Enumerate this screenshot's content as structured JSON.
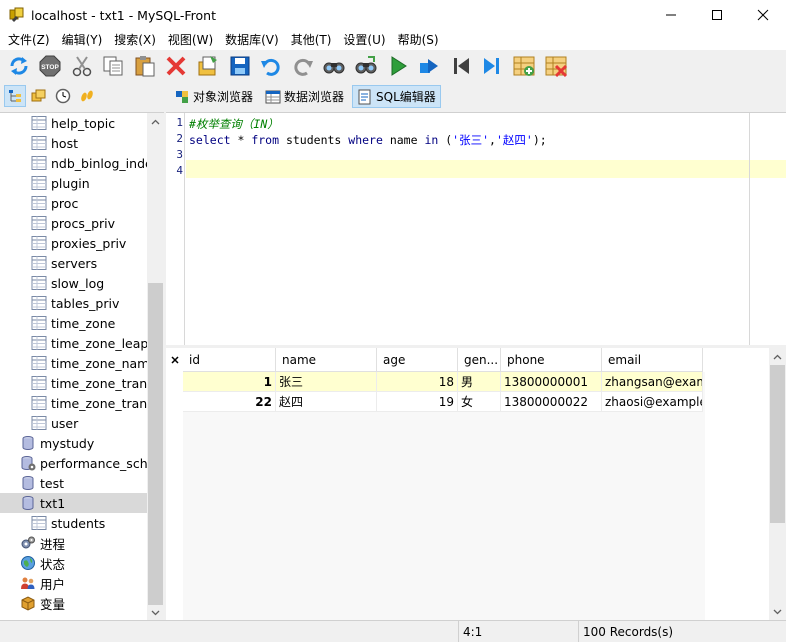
{
  "window": {
    "title": "localhost - txt1 - MySQL-Front"
  },
  "menu": [
    "文件(Z)",
    "编辑(Y)",
    "搜索(X)",
    "视图(W)",
    "数据库(V)",
    "其他(T)",
    "设置(U)",
    "帮助(S)"
  ],
  "toolbar": {
    "icons": [
      "refresh-icon",
      "stop-icon",
      "cut-icon",
      "copy-icon",
      "paste-icon",
      "delete-icon",
      "open-icon",
      "save-icon",
      "undo-icon",
      "redo-icon",
      "find-icon",
      "replace-icon",
      "run-icon",
      "run-selection-icon",
      "first-icon",
      "last-icon",
      "insert-row-icon",
      "delete-row-icon"
    ]
  },
  "view_tabs": [
    {
      "label": "对象浏览器",
      "active": false
    },
    {
      "label": "数据浏览器",
      "active": false
    },
    {
      "label": "SQL编辑器",
      "active": true
    }
  ],
  "tree": [
    {
      "label": "help_topic",
      "level": 2,
      "icon": "table-icon"
    },
    {
      "label": "host",
      "level": 2,
      "icon": "table-icon"
    },
    {
      "label": "ndb_binlog_index",
      "level": 2,
      "icon": "table-icon"
    },
    {
      "label": "plugin",
      "level": 2,
      "icon": "table-icon"
    },
    {
      "label": "proc",
      "level": 2,
      "icon": "table-icon"
    },
    {
      "label": "procs_priv",
      "level": 2,
      "icon": "table-icon"
    },
    {
      "label": "proxies_priv",
      "level": 2,
      "icon": "table-icon"
    },
    {
      "label": "servers",
      "level": 2,
      "icon": "table-icon"
    },
    {
      "label": "slow_log",
      "level": 2,
      "icon": "table-icon"
    },
    {
      "label": "tables_priv",
      "level": 2,
      "icon": "table-icon"
    },
    {
      "label": "time_zone",
      "level": 2,
      "icon": "table-icon"
    },
    {
      "label": "time_zone_leap_second",
      "level": 2,
      "icon": "table-icon"
    },
    {
      "label": "time_zone_name",
      "level": 2,
      "icon": "table-icon"
    },
    {
      "label": "time_zone_transition",
      "level": 2,
      "icon": "table-icon"
    },
    {
      "label": "time_zone_transition_type",
      "level": 2,
      "icon": "table-icon"
    },
    {
      "label": "user",
      "level": 2,
      "icon": "table-icon"
    },
    {
      "label": "mystudy",
      "level": 1,
      "icon": "database-icon"
    },
    {
      "label": "performance_schema",
      "level": 1,
      "icon": "system-database-icon"
    },
    {
      "label": "test",
      "level": 1,
      "icon": "database-icon"
    },
    {
      "label": "txt1",
      "level": 1,
      "icon": "database-icon",
      "selected": true
    },
    {
      "label": "students",
      "level": 2,
      "icon": "table-icon"
    },
    {
      "label": "进程",
      "level": 1,
      "icon": "process-icon"
    },
    {
      "label": "状态",
      "level": 1,
      "icon": "status-icon"
    },
    {
      "label": "用户",
      "level": 1,
      "icon": "users-icon"
    },
    {
      "label": "变量",
      "level": 1,
      "icon": "variables-icon"
    }
  ],
  "editor": {
    "line_numbers": [
      "1",
      "2",
      "3",
      "4"
    ],
    "line1_comment": "#枚举查询（IN）",
    "line2": {
      "kw_select": "select",
      "star": " * ",
      "kw_from": "from",
      "table": " students ",
      "kw_where": "where",
      "col": " name ",
      "kw_in": "in",
      "open": " (",
      "s1": "'张三'",
      "comma": ",",
      "s2": "'赵四'",
      "close": ");"
    },
    "current_line": 4
  },
  "results": {
    "columns": [
      "id",
      "name",
      "age",
      "gen...",
      "phone",
      "email"
    ],
    "rows": [
      {
        "id": "1",
        "name": "张三",
        "age": "18",
        "gender": "男",
        "phone": "13800000001",
        "email": "zhangsan@example.com"
      },
      {
        "id": "22",
        "name": "赵四",
        "age": "19",
        "gender": "女",
        "phone": "13800000022",
        "email": "zhaosi@example.com"
      }
    ]
  },
  "status": {
    "position": "4:1",
    "records": "100 Records(s)"
  }
}
